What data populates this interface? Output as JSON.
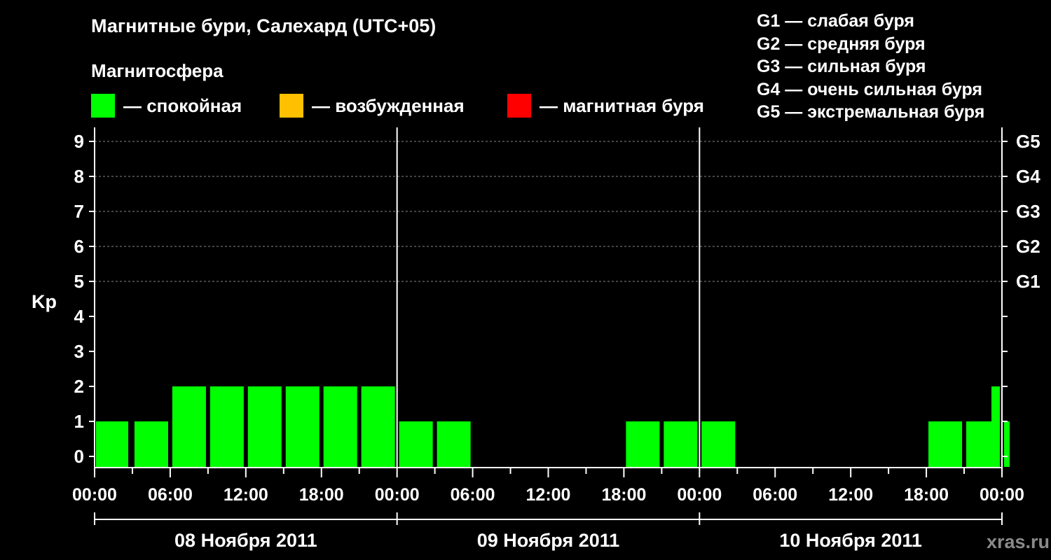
{
  "header": {
    "title": "Магнитные бури, Салехард (UTC+05)",
    "subtitle": "Магнитосфера"
  },
  "legend": [
    {
      "label": "— спокойная",
      "color": "#00ff00"
    },
    {
      "label": "— возбужденная",
      "color": "#ffc000"
    },
    {
      "label": "— магнитная буря",
      "color": "#ff0000"
    }
  ],
  "g_levels": [
    "G1 — слабая буря",
    "G2 — средняя буря",
    "G3 — сильная буря",
    "G4 — очень сильная буря",
    "G5 — экстремальная буря"
  ],
  "watermark": "xras.ru",
  "chart_data": {
    "type": "bar",
    "ylabel": "Kp",
    "ylim": [
      0,
      9
    ],
    "y_ticks": [
      "0",
      "1",
      "2",
      "3",
      "4",
      "5",
      "6",
      "7",
      "8",
      "9"
    ],
    "right_ticks": [
      {
        "value": 5,
        "label": "G1"
      },
      {
        "value": 6,
        "label": "G2"
      },
      {
        "value": 7,
        "label": "G3"
      },
      {
        "value": 8,
        "label": "G4"
      },
      {
        "value": 9,
        "label": "G5"
      }
    ],
    "x_tick_labels": [
      "00:00",
      "06:00",
      "12:00",
      "18:00",
      "00:00",
      "06:00",
      "12:00",
      "18:00",
      "00:00",
      "06:00",
      "12:00",
      "18:00",
      "00:00"
    ],
    "days": [
      "08 Ноября 2011",
      "09 Ноября 2011",
      "10 Ноября 2011"
    ],
    "grid": true,
    "colors": {
      "calm": "#00ff00",
      "excited": "#ffc000",
      "storm": "#ff0000"
    },
    "values": [
      1,
      1,
      2,
      2,
      2,
      2,
      2,
      2,
      1,
      1,
      0,
      0,
      0,
      0,
      1,
      1,
      1,
      0,
      0,
      0,
      0,
      0,
      1,
      1,
      1,
      2
    ]
  }
}
